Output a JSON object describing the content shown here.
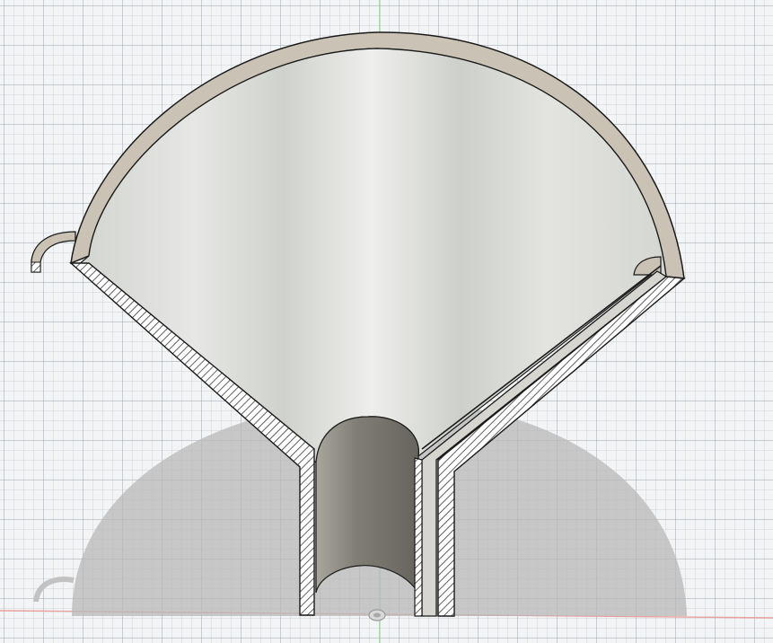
{
  "viewport": {
    "view": "3d-cad-section-view",
    "model": "funnel-section",
    "grid": true,
    "axes": {
      "vertical_axis_color": "#8fd88f",
      "horizontal_axis_color": "#e8a0a0"
    },
    "colors": {
      "background": "#f3f4f5",
      "funnel_surface": "#d9dbd5",
      "rim": "#c9c2b5",
      "section_hatch": "#3a3a3a",
      "edge": "#1a1a1a",
      "shadow": "#b8b8b8",
      "tube_inner": "#8c8a82"
    },
    "icons": {
      "origin": "origin-icon"
    }
  }
}
